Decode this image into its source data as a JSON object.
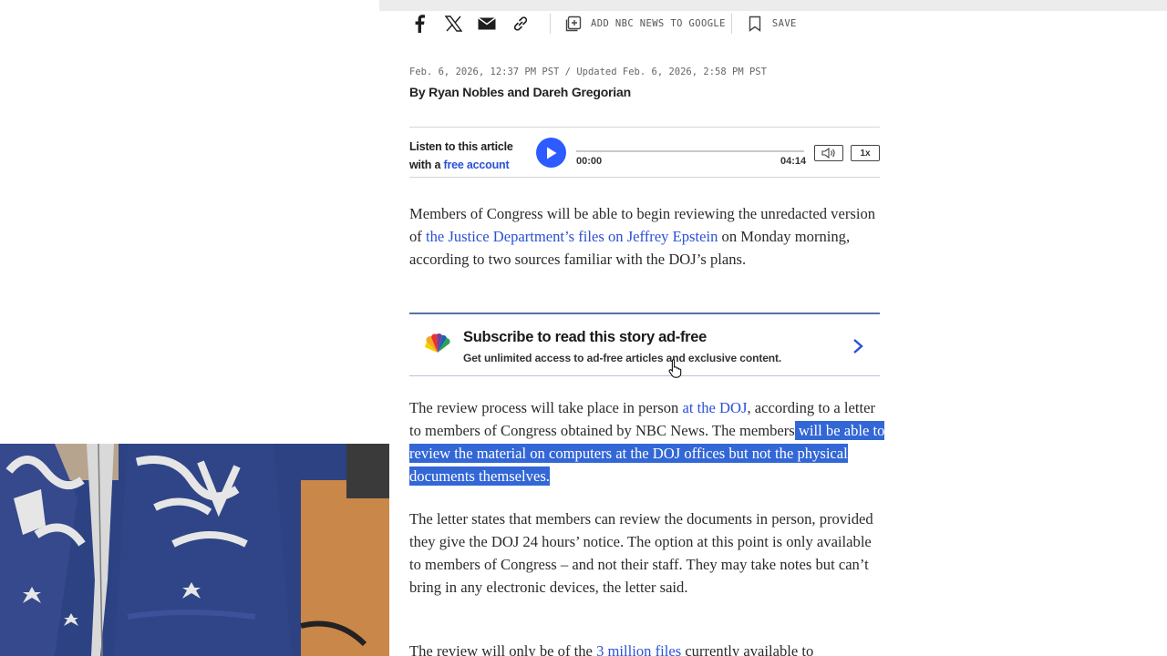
{
  "share": {
    "add_google_label": "ADD NBC NEWS TO GOOGLE",
    "save_label": "SAVE"
  },
  "article": {
    "dateline": "Feb. 6, 2026, 12:37 PM PST / Updated Feb. 6, 2026, 2:58 PM PST",
    "byline": "By Ryan Nobles and Dareh Gregorian"
  },
  "player": {
    "listen_line1": "Listen to this article",
    "listen_with": "with a ",
    "free_account_link": "free account",
    "current_time": "00:00",
    "duration": "04:14",
    "progress": 0.0,
    "speed": "1x"
  },
  "paragraphs": {
    "p1_a": "Members of Congress will be able to begin reviewing the unredacted version of ",
    "p1_link": "the Justice Department’s files on Jeffrey Epstein",
    "p1_b": " on Monday morning, according to two sources familiar with the DOJ’s plans.",
    "p2_a": "The review process will take place in person ",
    "p2_link": "at the DOJ",
    "p2_b": ", according to a letter to members of Congress obtained by NBC News. The members",
    "p2_highlight": " will be able to review the material on computers at the DOJ offices but not the physical documents themselves.",
    "p3": "The letter states that members can review the documents in person, provided they give the DOJ 24 hours’ notice. The option at this point is only available to members of Congress – and not their staff. They may take notes but can’t bring in any electronic devices, the letter said.",
    "p4_a": "The review will only be of the ",
    "p4_link": "3 million files",
    "p4_b": " currently available to"
  },
  "promo": {
    "title": "Subscribe to read this story ad-free",
    "subtitle": "Get unlimited access to ad-free articles and exclusive content."
  },
  "colors": {
    "link": "#2a51d6",
    "play_button": "#2d5bff",
    "highlight": "#3367d6",
    "promo_border": "#5a6fa5"
  }
}
